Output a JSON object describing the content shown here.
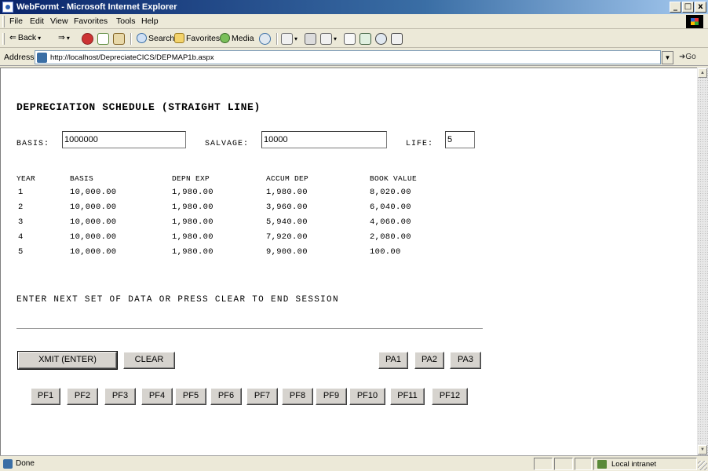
{
  "window": {
    "title": "WebFormt - Microsoft Internet Explorer",
    "min": "_",
    "max": "□",
    "close": "x"
  },
  "menu": [
    "File",
    "Edit",
    "View",
    "Favorites",
    "Tools",
    "Help"
  ],
  "toolbar": {
    "back": "Back",
    "search": "Search",
    "favorites": "Favorites",
    "media": "Media"
  },
  "address": {
    "label": "Address",
    "url": "http://localhost/DepreciateCICS/DEPMAP1b.aspx",
    "go": "Go"
  },
  "page": {
    "heading": "DEPRECIATION SCHEDULE (STRAIGHT LINE)",
    "basis_label": "BASIS:",
    "basis_value": "1000000",
    "salvage_label": "SALVAGE:",
    "salvage_value": "10000",
    "life_label": "LIFE:",
    "life_value": "5",
    "table": {
      "headers": [
        "YEAR",
        "BASIS",
        "DEPN EXP",
        "ACCUM DEP",
        "BOOK VALUE"
      ],
      "rows": [
        [
          "1",
          "10,000.00",
          "1,980.00",
          "1,980.00",
          "8,020.00"
        ],
        [
          "2",
          "10,000.00",
          "1,980.00",
          "3,960.00",
          "6,040.00"
        ],
        [
          "3",
          "10,000.00",
          "1,980.00",
          "5,940.00",
          "4,060.00"
        ],
        [
          "4",
          "10,000.00",
          "1,980.00",
          "7,920.00",
          "2,080.00"
        ],
        [
          "5",
          "10,000.00",
          "1,980.00",
          "9,900.00",
          "100.00"
        ]
      ]
    },
    "message": "ENTER NEXT SET OF DATA OR PRESS CLEAR TO END SESSION",
    "buttons": {
      "xmit": "XMIT (ENTER)",
      "clear": "CLEAR",
      "pa": [
        "PA1",
        "PA2",
        "PA3"
      ],
      "pf": [
        "PF1",
        "PF2",
        "PF3",
        "PF4",
        "PF5",
        "PF6",
        "PF7",
        "PF8",
        "PF9",
        "PF10",
        "PF11",
        "PF12"
      ]
    }
  },
  "status": {
    "text": "Done",
    "zone": "Local intranet"
  }
}
